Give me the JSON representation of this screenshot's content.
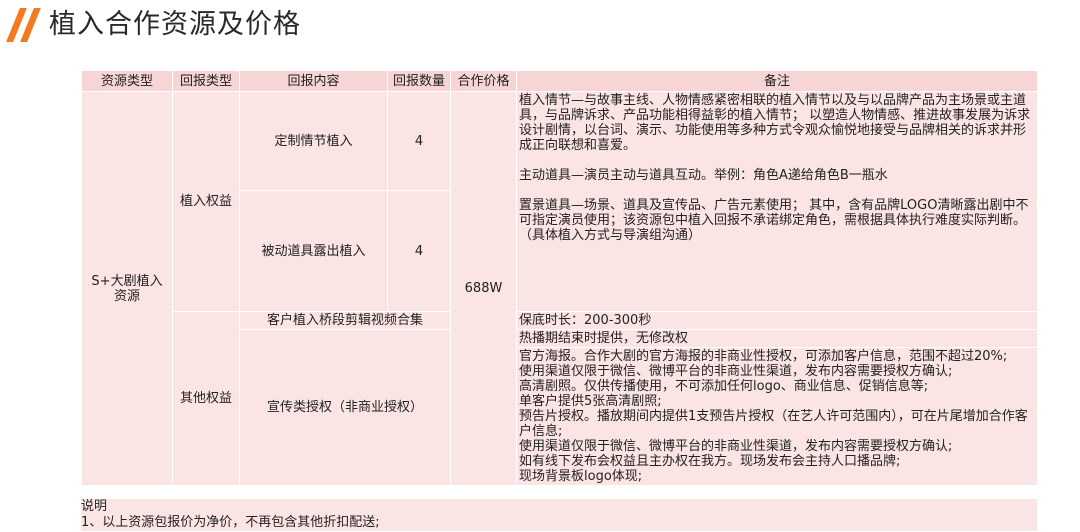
{
  "title": "植入合作资源及价格",
  "headers": [
    "资源类型",
    "回报类型",
    "回报内容",
    "回报数量",
    "合作价格",
    "备注"
  ],
  "resource_type": "S+大剧植入\n资源",
  "price": "688W",
  "categories": [
    {
      "name": "植入权益",
      "items": [
        {
          "content": "定制情节植入",
          "qty": "4"
        },
        {
          "content": "被动道具露出植入",
          "qty": "4"
        }
      ]
    },
    {
      "name": "其他权益",
      "items": [
        {
          "content": "客户植入桥段剪辑视频合集"
        },
        {
          "content": "宣传类授权（非商业授权）"
        }
      ]
    }
  ],
  "notes": {
    "implant_1": "植入情节—与故事主线、人物情感紧密相联的植入情节以及与以品牌产品为主场景或主道具，与品牌诉求、产品功能相得益彰的植入情节； 以塑造人物情感、推进故事发展为诉求设计剧情，以台词、演示、功能使用等多种方式令观众愉悦地接受与品牌相关的诉求并形成正向联想和喜爱。",
    "implant_2": "主动道具—演员主动与道具互动。举例：角色A递给角色B一瓶水",
    "implant_3": "置景道具—场景、道具及宣传品、广告元素使用； 其中，含有品牌LOGO清晰露出剧中不可指定演员使用；该资源包中植入回报不承诺绑定角色，需根据具体执行难度实际判断。",
    "implant_4": "（具体植入方式与导演组沟通）",
    "video_1": "保底时长：200-300秒",
    "video_2": "热播期结束时提供，无修改权",
    "promo_1": "官方海报。合作大剧的官方海报的非商业性授权，可添加客户信息，范围不超过20%;",
    "promo_2": "使用渠道仅限于微信、微博平台的非商业性渠道，发布内容需要授权方确认;",
    "promo_3": "高清剧照。仅供传播使用，不可添加任何logo、商业信息、促销信息等;",
    "promo_4": "单客户提供5张高清剧照;",
    "promo_5": "预告片授权。播放期间内提供1支预告片授权（在艺人许可范围内），可在片尾增加合作客户信息;",
    "promo_6": "使用渠道仅限于微信、微博平台的非商业性渠道，发布内容需要授权方确认;",
    "promo_7": "如有线下发布会权益且主办权在我方。现场发布会主持人口播品牌;",
    "promo_8": "现场背景板logo体现;"
  },
  "footer": {
    "heading": "说明",
    "line1": "1、以上资源包报价为净价，不再包含其他折扣配送;"
  },
  "colors": {
    "accent": "#f37a1f",
    "header_bg": "#f8d5d5",
    "cell_bg": "#fbe4e4"
  }
}
